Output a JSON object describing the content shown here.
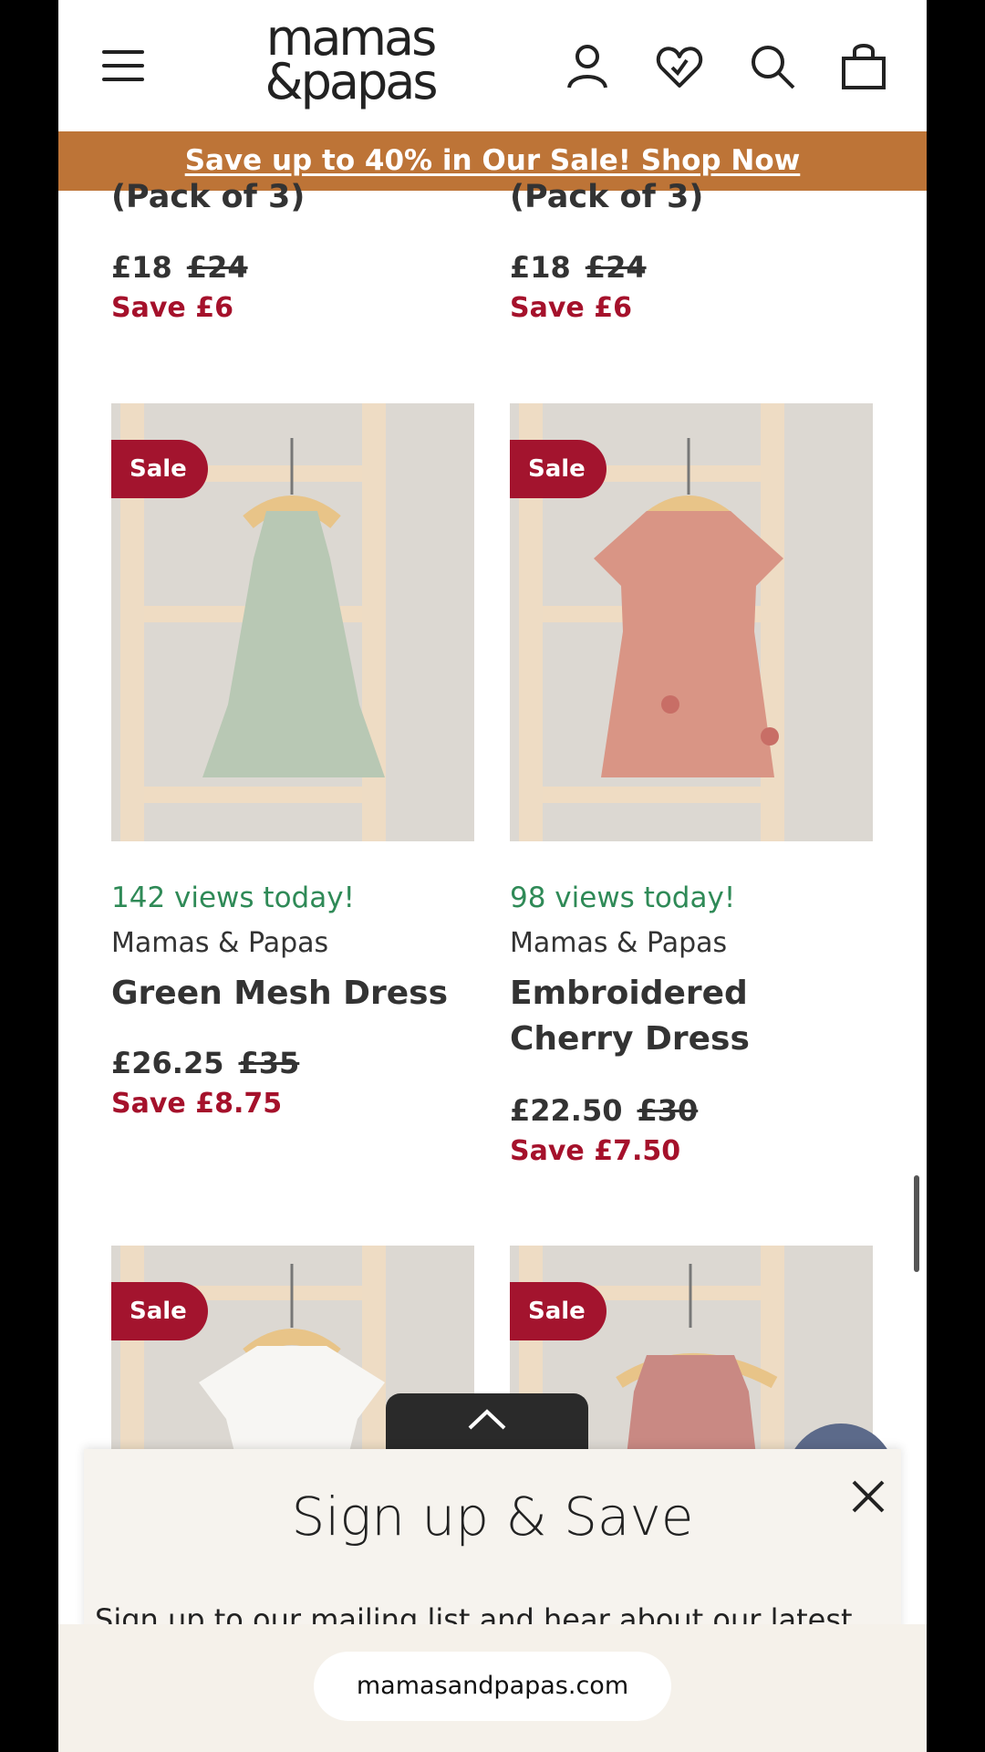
{
  "header": {
    "logo_line1": "mamas",
    "logo_line2": "&papas"
  },
  "promo": {
    "text": "Save up to 40% in Our Sale! Shop Now"
  },
  "top_products": [
    {
      "title_fragment": "(Pack of 3)",
      "price": "£18",
      "was_price": "£24",
      "save": "Save £6"
    },
    {
      "title_fragment": "(Pack of 3)",
      "price": "£18",
      "was_price": "£24",
      "save": "Save £6"
    }
  ],
  "products": [
    {
      "badge": "Sale",
      "views": "142 views today!",
      "brand": "Mamas & Papas",
      "name": "Green Mesh Dress",
      "price": "£26.25",
      "was_price": "£35",
      "save": "Save £8.75",
      "dress_color": "#b8c8b4"
    },
    {
      "badge": "Sale",
      "views": "98 views today!",
      "brand": "Mamas & Papas",
      "name": "Embroidered Cherry Dress",
      "price": "£22.50",
      "was_price": "£30",
      "save": "Save £7.50",
      "dress_color": "#d99585"
    }
  ],
  "bottom_products": [
    {
      "badge": "Sale",
      "dress_color": "#f7f6f3"
    },
    {
      "badge": "Sale",
      "dress_color": "#c98983"
    }
  ],
  "signup": {
    "title": "Sign up & Save",
    "text": "Sign up to our mailing list and hear about our latest"
  },
  "browser": {
    "url": "mamasandpapas.com"
  },
  "colors": {
    "promo_bg": "#bd7437",
    "sale_red": "#a3142e",
    "views_green": "#2f8a57"
  }
}
